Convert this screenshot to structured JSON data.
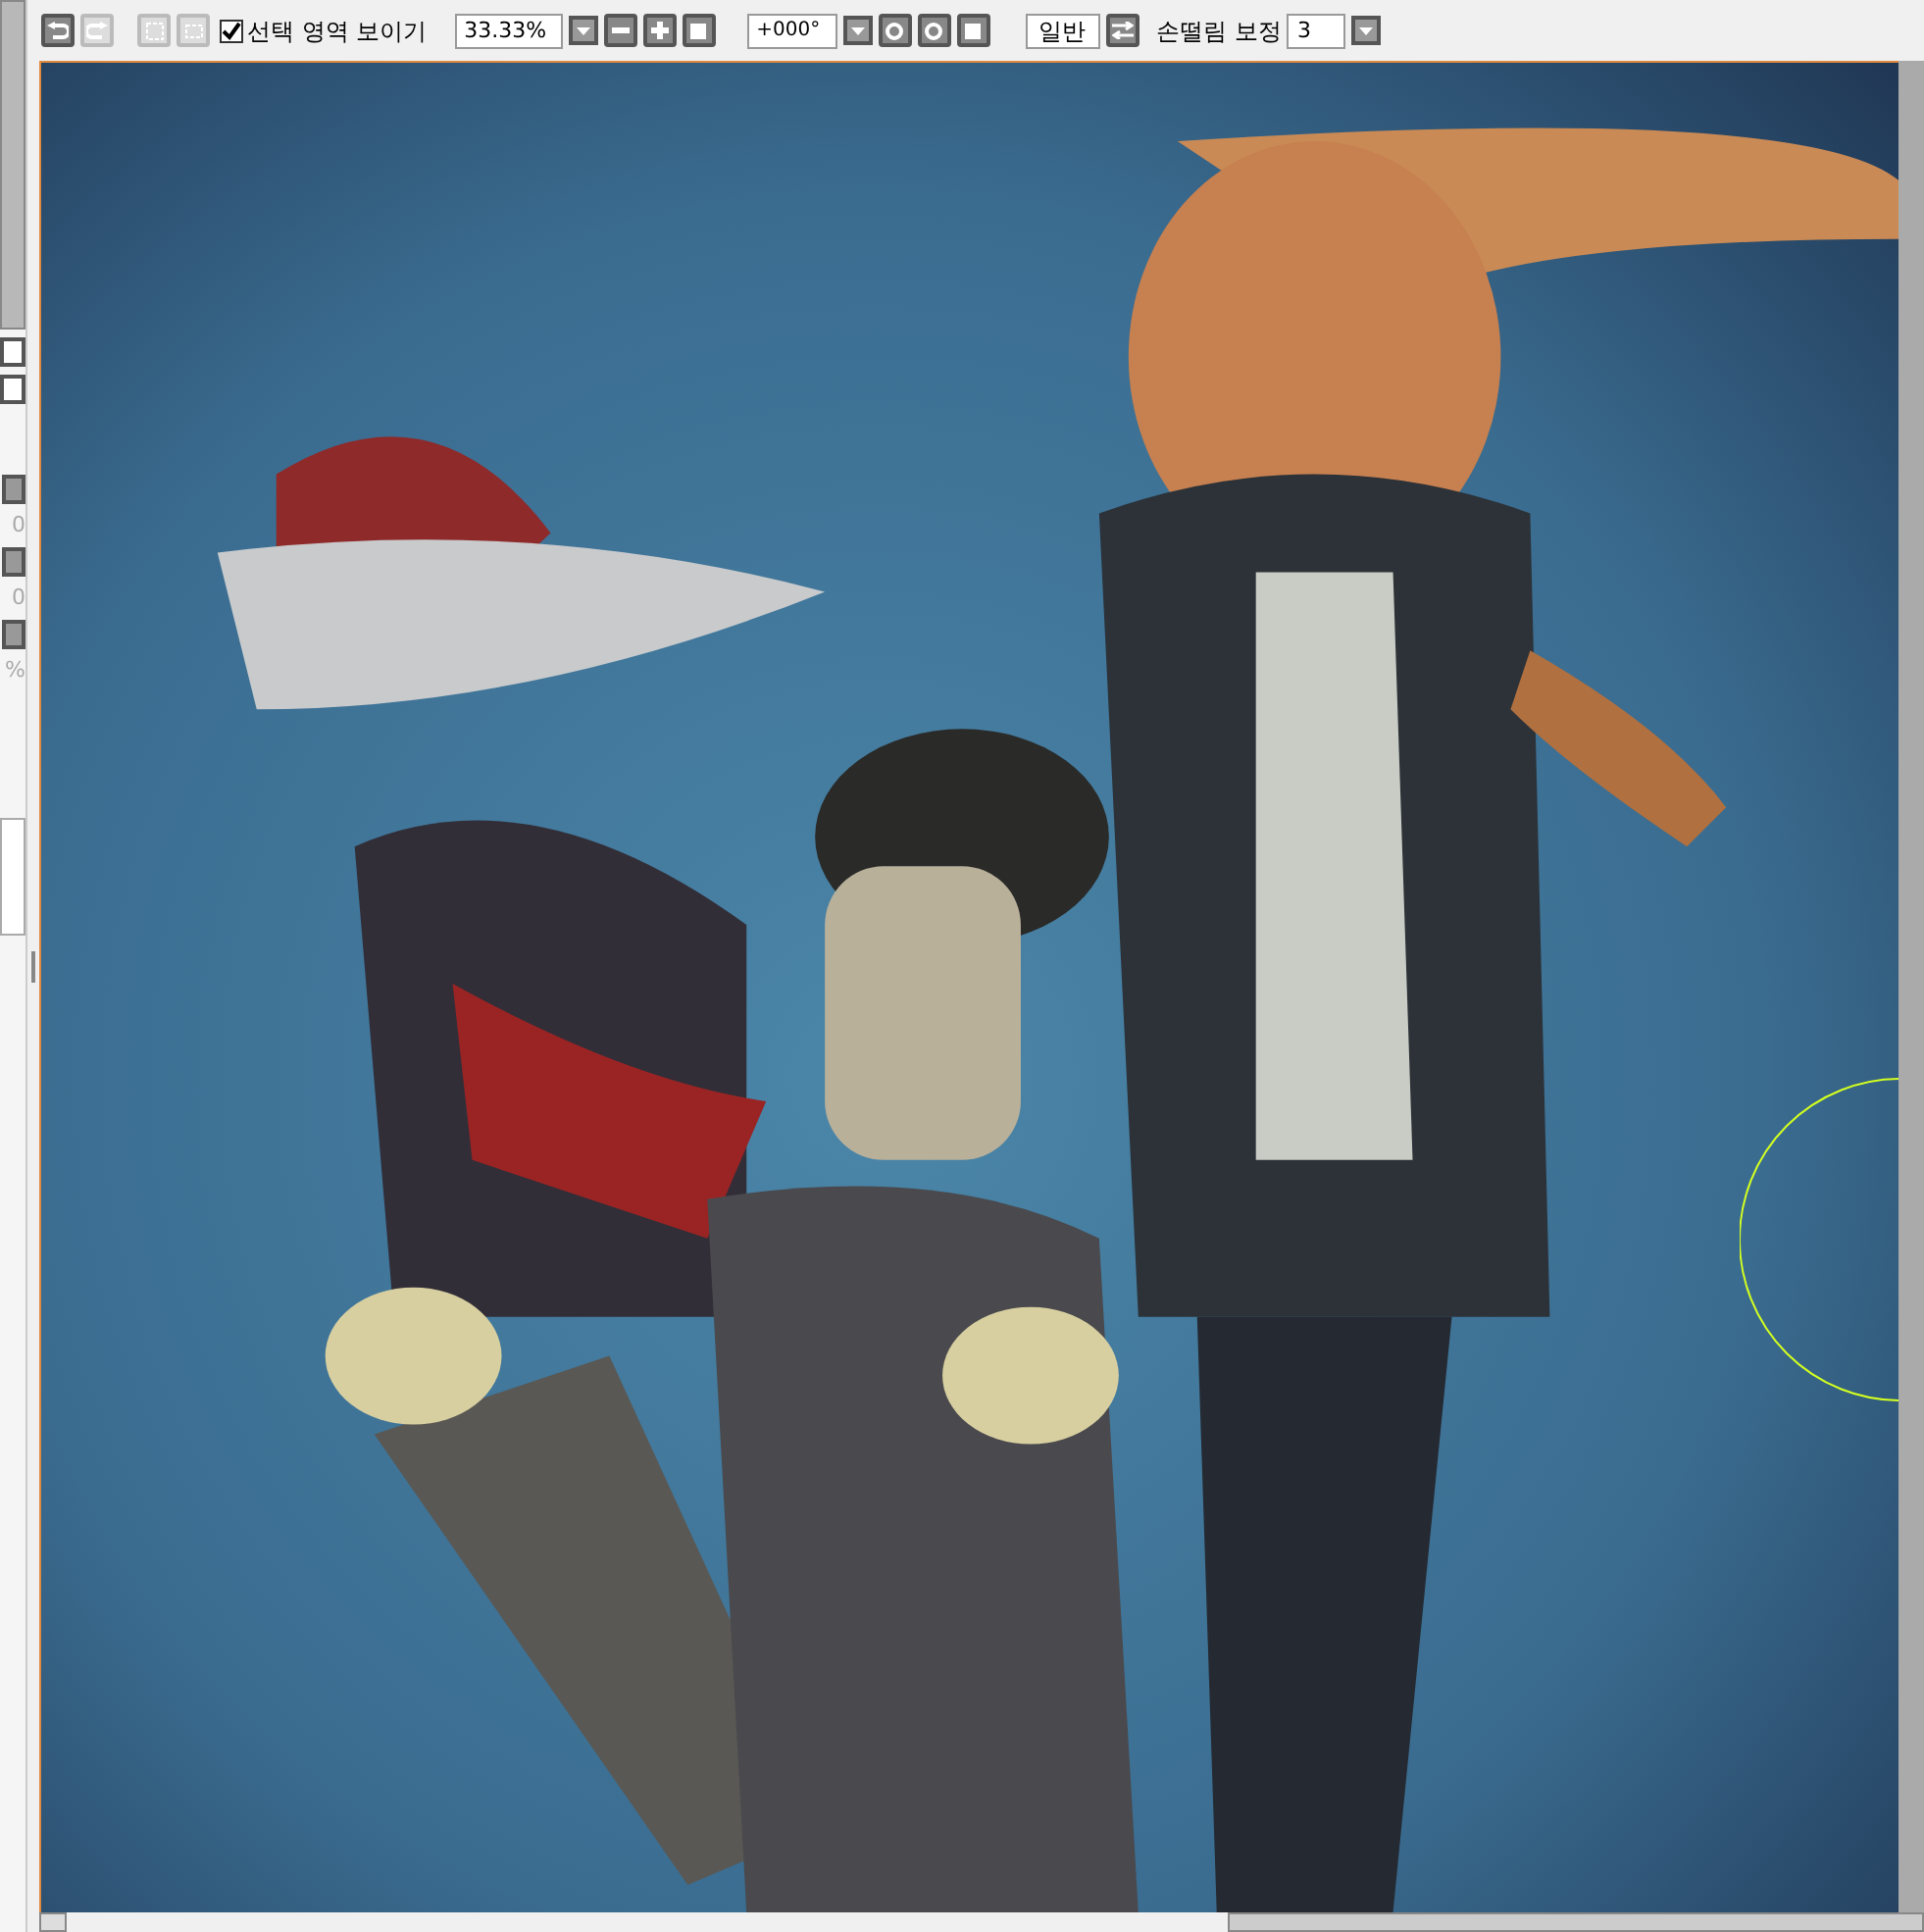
{
  "toolbar": {
    "undo": {
      "disabled": false
    },
    "redo": {
      "disabled": true
    },
    "show_selection": {
      "label": "선택 영역 보이기",
      "checked": true
    },
    "zoom": "33.33%",
    "rotation": "+000°",
    "blend_mode": "일반",
    "stabilizer": {
      "label": "손떨림 보정",
      "value": "3"
    }
  },
  "left_panel": {
    "texts": [
      "0",
      "0",
      "%"
    ]
  }
}
